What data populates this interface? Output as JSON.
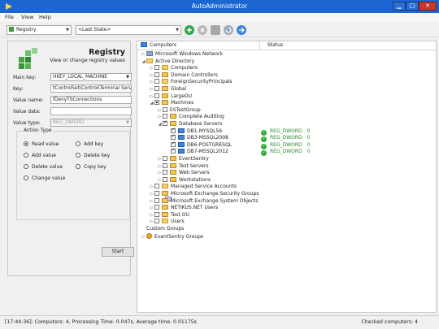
{
  "window": {
    "title": "AutoAdministrator",
    "min_label": "▁",
    "max_label": "□",
    "close_label": "✕"
  },
  "menu": [
    "File",
    "View",
    "Help"
  ],
  "toolbar": {
    "module_select": "Registry",
    "state_select": "<Last State>",
    "buttons": [
      "add-icon",
      "remove-icon",
      "settings-icon",
      "refresh-icon",
      "start-icon"
    ],
    "colors": {
      "add": "#2ea84a",
      "remove": "#b9b9b9",
      "settings": "#a8a8a8",
      "refresh": "#9aa9bf",
      "start": "#3d7fd8"
    }
  },
  "registry_panel": {
    "title": "Registry",
    "subtitle": "View or change registry values",
    "main_key_label": "Main key:",
    "main_key_value": "HKEY_LOCAL_MACHINE",
    "key_label": "Key:",
    "key_value": "tControlSet\\Control\\Terminal Server",
    "value_name_label": "Value name:",
    "value_name_value": "fDenyTSConnections",
    "value_data_label": "Value data:",
    "value_data_value": "",
    "value_type_label": "Value type:",
    "value_type_value": "REG_DWORD",
    "action_type_label": "Action Type",
    "actions": [
      {
        "label": "Read value",
        "selected": true
      },
      {
        "label": "Add key",
        "selected": false
      },
      {
        "label": "Add value",
        "selected": false
      },
      {
        "label": "Delete key",
        "selected": false
      },
      {
        "label": "Delete value",
        "selected": false
      },
      {
        "label": "Copy key",
        "selected": false
      },
      {
        "label": "Change value",
        "selected": false
      }
    ],
    "start_label": "Start"
  },
  "computers_view": {
    "col_computers": "Computers",
    "col_status": "Status",
    "rows": [
      {
        "label": "Microsoft Windows Network",
        "indent": 0,
        "exp": "▷",
        "cb": null,
        "icon": "network"
      },
      {
        "label": "Active Directory",
        "indent": 0,
        "exp": "◢",
        "cb": null,
        "icon": "ad"
      },
      {
        "label": "Computers",
        "indent": 1,
        "exp": "▷",
        "cb": "",
        "icon": "folder"
      },
      {
        "label": "Domain Controllers",
        "indent": 1,
        "exp": "▷",
        "cb": "",
        "icon": "ou"
      },
      {
        "label": "ForeignSecurityPrincipals",
        "indent": 1,
        "exp": "▷",
        "cb": "",
        "icon": "folder"
      },
      {
        "label": "Global",
        "indent": 1,
        "exp": "▷",
        "cb": "",
        "icon": "ou"
      },
      {
        "label": "LargeOU",
        "indent": 1,
        "exp": "▷",
        "cb": "",
        "icon": "ou"
      },
      {
        "label": "Machines",
        "indent": 1,
        "exp": "◢",
        "cb": "partial",
        "icon": "ou"
      },
      {
        "label": "ESTestGroup",
        "indent": 2,
        "exp": "▷",
        "cb": "",
        "icon": "group"
      },
      {
        "label": "Complete Auditing",
        "indent": 2,
        "exp": "▷",
        "cb": "",
        "icon": "ou"
      },
      {
        "label": "Database Servers",
        "indent": 2,
        "exp": "◢",
        "cb": "checked",
        "icon": "ou"
      },
      {
        "label": "DB1-MYSQL56",
        "indent": 3,
        "exp": "",
        "cb": "checked",
        "icon": "server"
      },
      {
        "label": "DB3-MSSQL2008",
        "indent": 3,
        "exp": "",
        "cb": "checked",
        "icon": "server"
      },
      {
        "label": "DB6-POSTGRESQL",
        "indent": 3,
        "exp": "",
        "cb": "checked",
        "icon": "server"
      },
      {
        "label": "DB7-MSSQL2012",
        "indent": 3,
        "exp": "",
        "cb": "checked",
        "icon": "server"
      },
      {
        "label": "EventSentry",
        "indent": 2,
        "exp": "▷",
        "cb": "",
        "icon": "ou"
      },
      {
        "label": "Test Servers",
        "indent": 2,
        "exp": "▷",
        "cb": "",
        "icon": "ou"
      },
      {
        "label": "Web Servers",
        "indent": 2,
        "exp": "▷",
        "cb": "",
        "icon": "ou"
      },
      {
        "label": "Workstations",
        "indent": 2,
        "exp": "▷",
        "cb": "",
        "icon": "ou"
      },
      {
        "label": "Managed Service Accounts",
        "indent": 1,
        "exp": "▷",
        "cb": "",
        "icon": "folder"
      },
      {
        "label": "Microsoft Exchange Security Groups",
        "indent": 1,
        "exp": "▷",
        "cb": "",
        "icon": "ou"
      },
      {
        "label": "Microsoft Exchange System Objects",
        "indent": 1,
        "exp": "▷",
        "cb": "",
        "icon": "ou"
      },
      {
        "label": "NETIKUS.NET Users",
        "indent": 1,
        "exp": "▷",
        "cb": "",
        "icon": "ou"
      },
      {
        "label": "Test OU",
        "indent": 1,
        "exp": "▷",
        "cb": "",
        "icon": "ou"
      },
      {
        "label": "Users",
        "indent": 1,
        "exp": "▷",
        "cb": "",
        "icon": "folder"
      },
      {
        "label": "Custom Groups",
        "indent": 0,
        "exp": "",
        "cb": null,
        "icon": "group"
      },
      {
        "label": "EventSentry Groups",
        "indent": 0,
        "exp": "▷",
        "cb": null,
        "icon": "es"
      }
    ],
    "statuses": [
      {
        "row": 11,
        "type": "REG_DWORD",
        "value": "0"
      },
      {
        "row": 12,
        "type": "REG_DWORD",
        "value": "0"
      },
      {
        "row": 13,
        "type": "REG_DWORD",
        "value": "0"
      },
      {
        "row": 14,
        "type": "REG_DWORD",
        "value": "0"
      }
    ]
  },
  "statusbar": {
    "left": "[17:44:36]: Computers: 4, Processing Time: 0.047s, Average time: 0.01175s",
    "right": "Checked computers: 4"
  }
}
